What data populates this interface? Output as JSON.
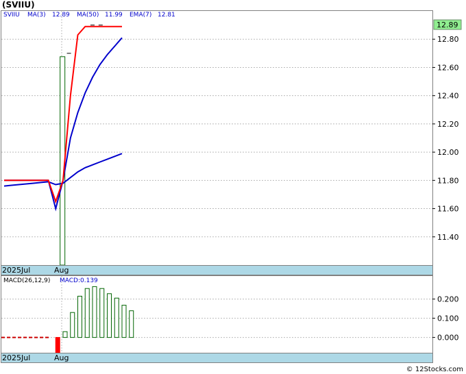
{
  "title": "(SVIIU)",
  "footer": "© 12Stocks.com",
  "legend": {
    "symbol": "SVIIU",
    "ma3_label": "MA(3)",
    "ma3_value": "12.89",
    "ma50_label": "MA(50)",
    "ma50_value": "11.99",
    "ema7_label": "EMA(7)",
    "ema7_value": "12.81"
  },
  "last_price_tag": "12.89",
  "macd_legend": {
    "label": "MACD(26,12,9)",
    "value_text": "MACD:0.139"
  },
  "colors": {
    "bg": "#ffffff",
    "axis_band": "#add8e6",
    "grid": "#bbbbbb",
    "ma3": "#ff0000",
    "ma50": "#0000cc",
    "ema7": "#0000cc",
    "volume": "#006400",
    "macd_pos": "#006400",
    "macd_neg": "#ff0000",
    "price_tag_bg": "#90ee90",
    "legend_text": "#0000cc"
  },
  "x_labels": [
    {
      "text": "2025Jul",
      "panel": "price"
    },
    {
      "text": "Aug",
      "panel": "price"
    },
    {
      "text": "2025Jul",
      "panel": "macd"
    },
    {
      "text": "Aug",
      "panel": "macd"
    }
  ],
  "chart_data": [
    {
      "type": "line",
      "name": "price",
      "x": [
        0,
        1,
        2,
        3,
        4,
        5,
        6,
        7,
        8,
        9,
        10,
        11,
        12,
        13,
        14,
        15,
        16
      ],
      "x_tick_labels": [
        "2025Jul",
        "Aug"
      ],
      "ylim": [
        11.2,
        13.0
      ],
      "y_ticks": [
        11.4,
        11.6,
        11.8,
        12.0,
        12.2,
        12.4,
        12.6,
        12.8
      ],
      "y_tick_labels": [
        "11.40",
        "11.60",
        "11.80",
        "12.00",
        "12.20",
        "12.40",
        "12.60",
        "12.80"
      ],
      "series": [
        {
          "name": "MA(3)",
          "values": [
            11.8,
            11.8,
            11.8,
            11.8,
            11.8,
            11.8,
            11.8,
            11.65,
            11.8,
            12.4,
            12.83,
            12.89,
            12.89,
            12.89,
            12.89,
            12.89,
            12.89
          ]
        },
        {
          "name": "MA(50)",
          "values": [
            11.76,
            11.765,
            11.77,
            11.775,
            11.78,
            11.785,
            11.79,
            11.77,
            11.78,
            11.82,
            11.86,
            11.89,
            11.91,
            11.93,
            11.95,
            11.97,
            11.99
          ]
        },
        {
          "name": "EMA(7)",
          "values": [
            11.8,
            11.8,
            11.8,
            11.8,
            11.8,
            11.8,
            11.8,
            11.6,
            11.8,
            12.1,
            12.28,
            12.42,
            12.53,
            12.62,
            12.69,
            12.75,
            12.81
          ]
        }
      ],
      "volume_bar": {
        "x": 7.6,
        "height_fraction": 0.82
      },
      "tick_marks": [
        {
          "x": 8.8,
          "y": 12.7
        },
        {
          "x": 12.0,
          "y": 12.9
        },
        {
          "x": 13.1,
          "y": 12.9
        }
      ]
    },
    {
      "type": "bar",
      "name": "MACD(26,12,9)",
      "x_tick_labels": [
        "2025Jul",
        "Aug"
      ],
      "ylim": [
        -0.08,
        0.32
      ],
      "y_ticks": [
        0.0,
        0.1,
        0.2
      ],
      "y_tick_labels": [
        "0.000",
        "0.100",
        "0.200"
      ],
      "signal_line_value": 0.0,
      "bars": [
        {
          "x": 7,
          "value": -0.08
        },
        {
          "x": 8,
          "value": 0.03
        },
        {
          "x": 9,
          "value": 0.13
        },
        {
          "x": 10,
          "value": 0.215
        },
        {
          "x": 11,
          "value": 0.255
        },
        {
          "x": 12,
          "value": 0.265
        },
        {
          "x": 13,
          "value": 0.255
        },
        {
          "x": 14,
          "value": 0.228
        },
        {
          "x": 15,
          "value": 0.205
        },
        {
          "x": 16,
          "value": 0.168
        },
        {
          "x": 17,
          "value": 0.139
        }
      ]
    }
  ]
}
